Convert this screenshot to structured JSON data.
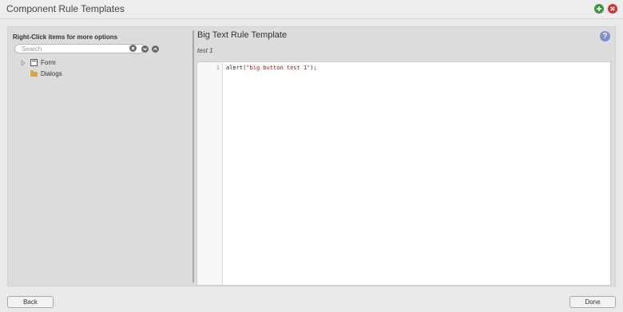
{
  "window": {
    "title": "Component Rule Templates"
  },
  "left_pane": {
    "heading": "Right-Click items for more options",
    "search": {
      "placeholder": "Search",
      "value": ""
    },
    "tree": [
      {
        "label": "Form",
        "icon": "form-icon",
        "expanded": false
      },
      {
        "label": "Dialogs",
        "icon": "folder-icon"
      }
    ]
  },
  "right_pane": {
    "title": "Big Text Rule Template",
    "subtitle": "test 1",
    "editor": {
      "line_number": "1",
      "code_prefix": "alert(",
      "code_string": "\"big button test 1\"",
      "code_suffix": ");"
    }
  },
  "footer": {
    "back_label": "Back",
    "done_label": "Done"
  },
  "colors": {
    "add_button": "#3a9a3a",
    "close_button": "#d9322e",
    "help_icon": "#7d8fd1",
    "folder": "#d9a441",
    "code_string": "#a31515"
  }
}
